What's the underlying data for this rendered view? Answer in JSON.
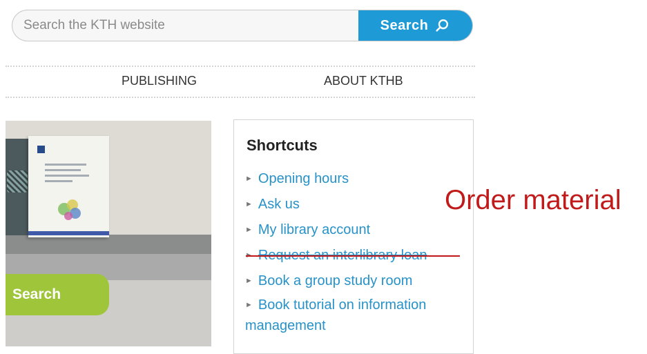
{
  "search": {
    "placeholder": "Search the KTH website",
    "button_label": "Search",
    "button_color": "#1e9ad6"
  },
  "nav": {
    "items": [
      {
        "label": "PUBLISHING"
      },
      {
        "label": "ABOUT KTHB"
      }
    ]
  },
  "hero": {
    "search_label": "Search",
    "search_color": "#9fc63b"
  },
  "shortcuts": {
    "title": "Shortcuts",
    "items": [
      {
        "label": "Opening hours",
        "struck": false
      },
      {
        "label": "Ask us",
        "struck": false
      },
      {
        "label": "My library account",
        "struck": false
      },
      {
        "label": "Request an interlibrary loan",
        "struck": true
      },
      {
        "label": "Book a group study room",
        "struck": false
      },
      {
        "label": "Book tutorial on information management",
        "struck": false
      }
    ],
    "link_color": "#2792c8"
  },
  "annotation": {
    "text": "Order material",
    "color": "#c01a1a"
  },
  "icons": {
    "search_button_icon": "search-icon",
    "shortcut_bullet_icon": "triangle-right-icon"
  }
}
